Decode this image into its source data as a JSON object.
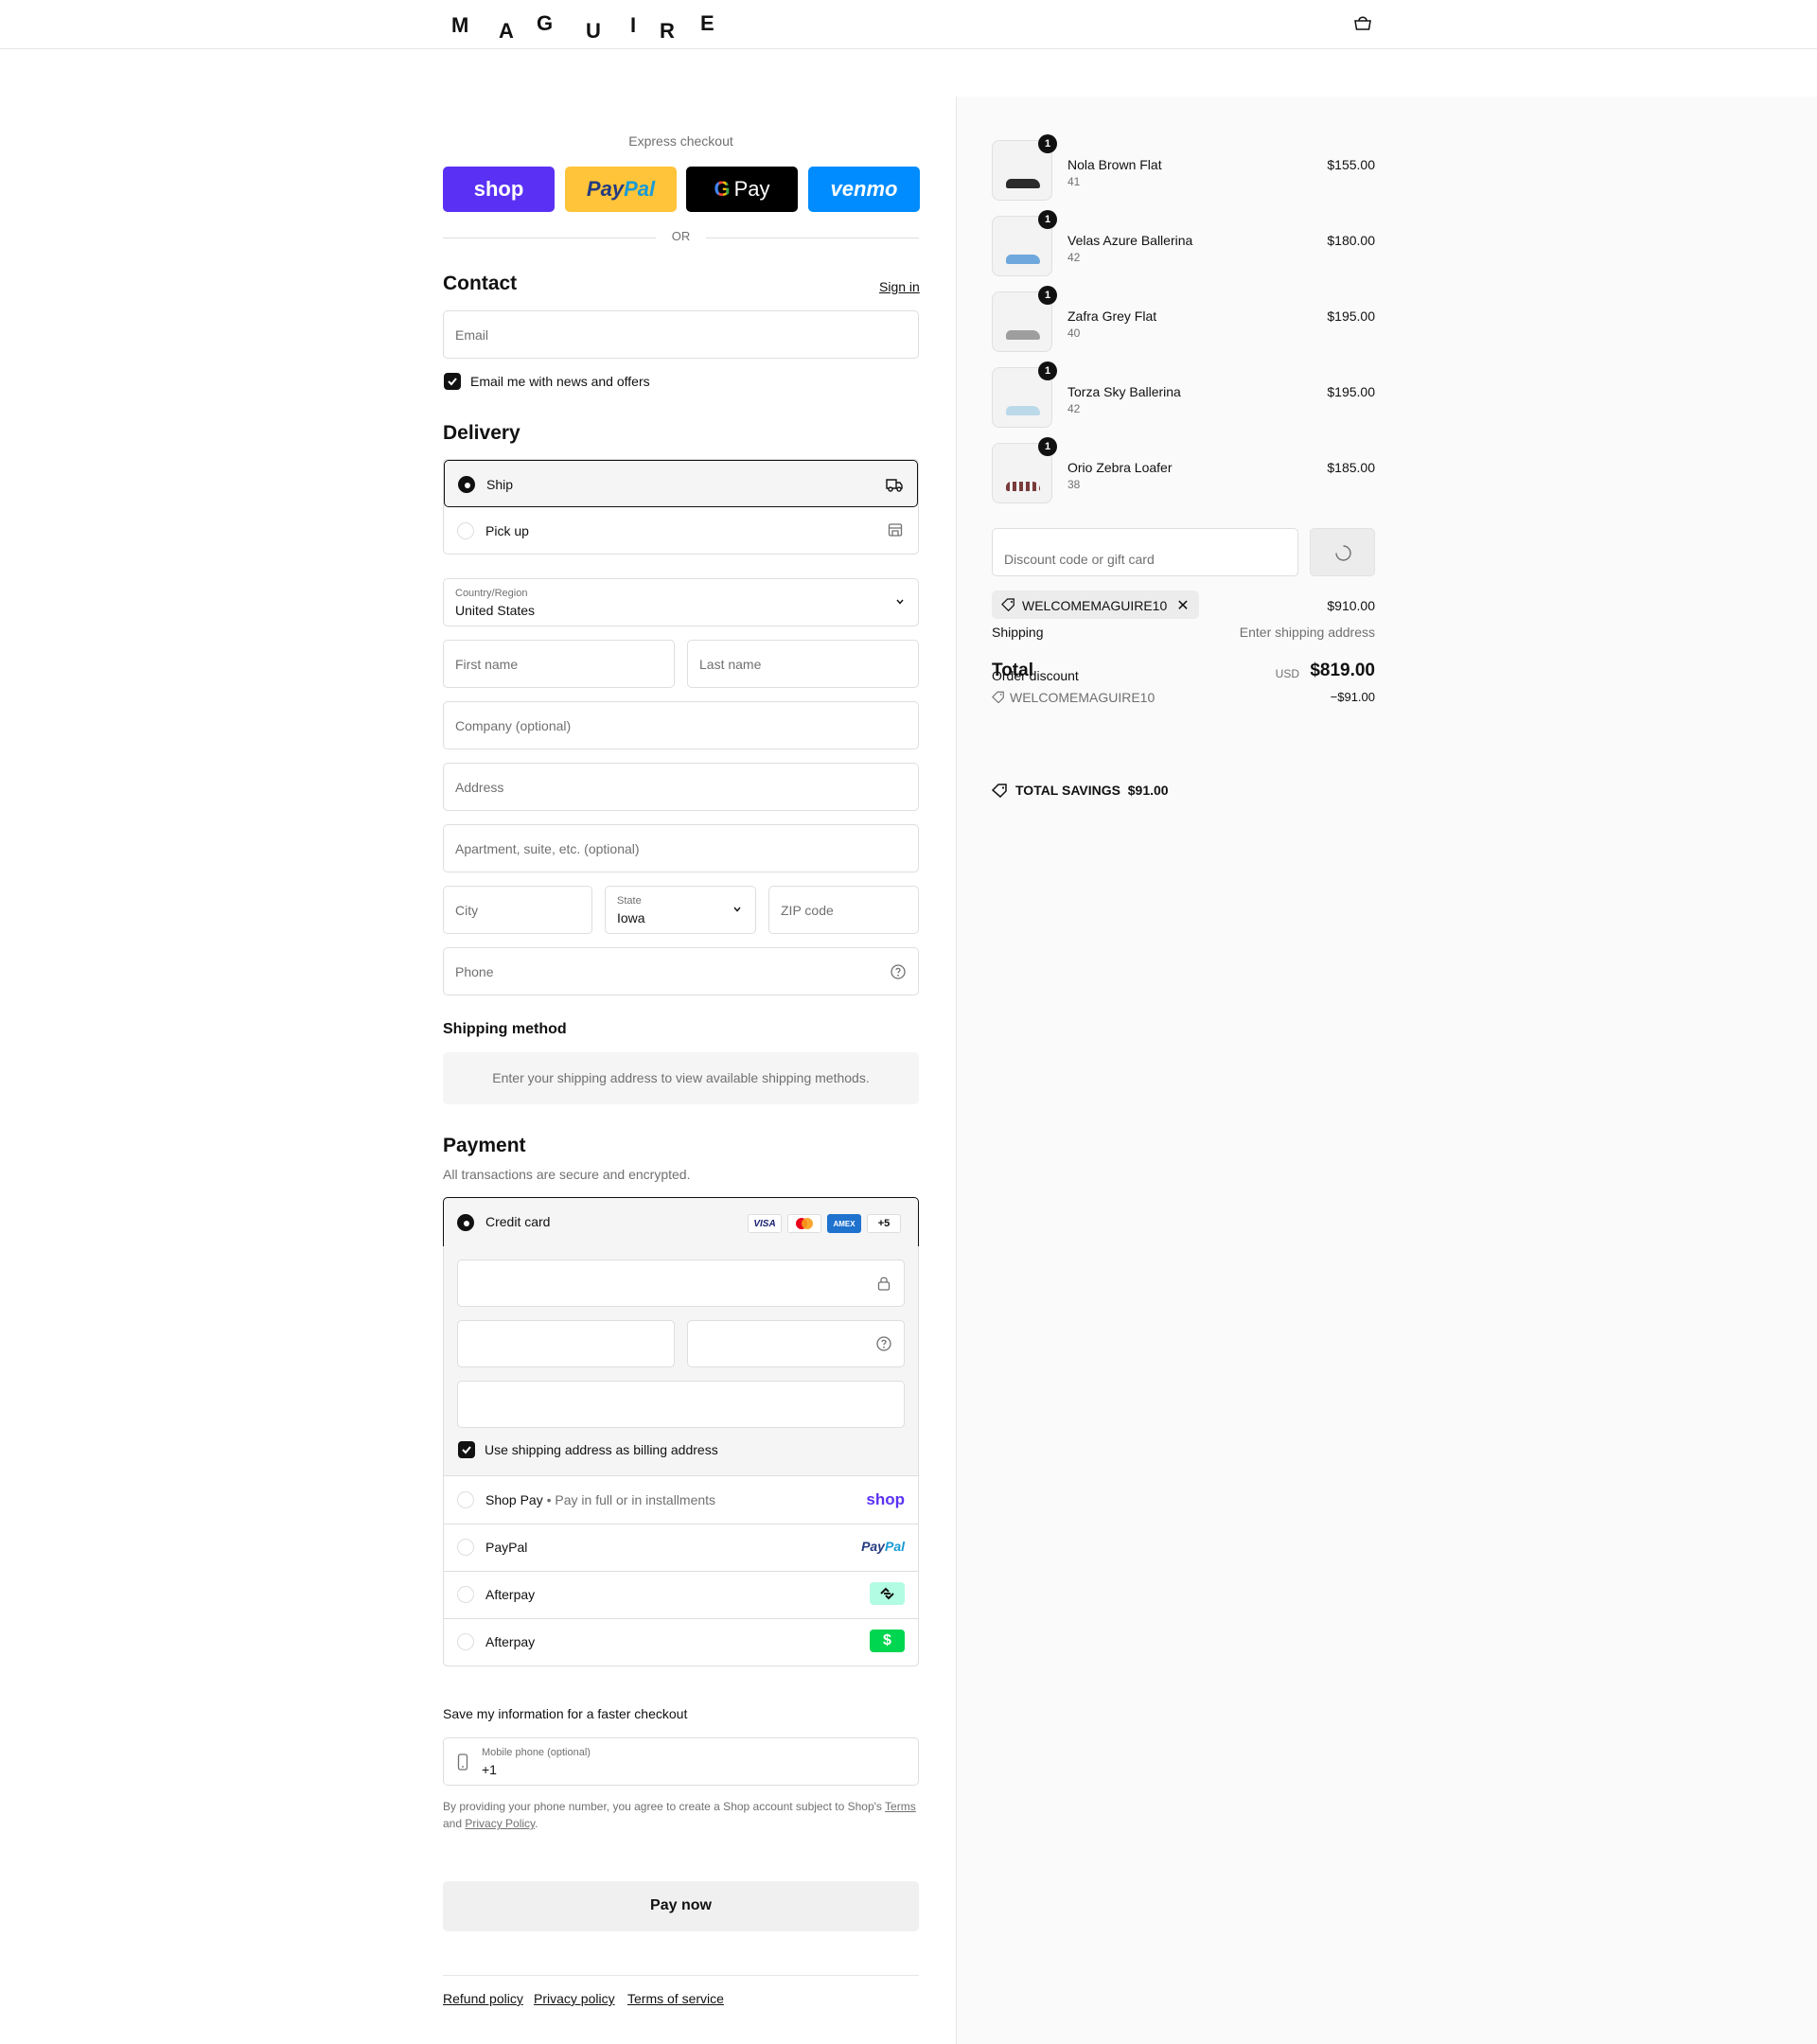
{
  "brand": {
    "letters": [
      "M",
      "A",
      "G",
      "U",
      "I",
      "R",
      "E"
    ]
  },
  "header": {
    "cart_icon": "bag-icon"
  },
  "express": {
    "title": "Express checkout",
    "buttons": {
      "shop": "shop",
      "paypal_a": "Pay",
      "paypal_b": "Pal",
      "gpay_g": "G",
      "gpay": "Pay",
      "venmo": "venmo"
    },
    "or": "OR"
  },
  "contact": {
    "heading": "Contact",
    "sign_in": "Sign in",
    "email_placeholder": "Email",
    "news_label": "Email me with news and offers"
  },
  "delivery": {
    "heading": "Delivery",
    "options": [
      {
        "label": "Ship",
        "icon": "truck-icon"
      },
      {
        "label": "Pick up",
        "icon": "store-icon"
      }
    ],
    "country_label": "Country/Region",
    "country_value": "United States",
    "first_name": "First name",
    "last_name": "Last name",
    "company": "Company (optional)",
    "address": "Address",
    "apartment": "Apartment, suite, etc. (optional)",
    "city": "City",
    "state_label": "State",
    "state_value": "Iowa",
    "zip": "ZIP code",
    "phone": "Phone"
  },
  "shipping_method": {
    "heading": "Shipping method",
    "notice": "Enter your shipping address to view available shipping methods."
  },
  "payment": {
    "heading": "Payment",
    "subtitle": "All transactions are secure and encrypted.",
    "credit_card": "Credit card",
    "brands": [
      "VISA",
      "AMEX"
    ],
    "more": "+5",
    "billing_label": "Use shipping address as billing address",
    "shop_pay": "Shop Pay",
    "shop_pay_sub": "Pay in full or in installments",
    "shop_pay_logo": "shop",
    "paypal": "PayPal",
    "paypal_logo_a": "Pay",
    "paypal_logo_b": "Pal",
    "afterpay_1": "Afterpay",
    "afterpay_2": "Afterpay",
    "cash_symbol": "$"
  },
  "save_info": {
    "heading": "Save my information for a faster checkout",
    "phone_label": "Mobile phone (optional)",
    "phone_value": "+1",
    "legal_1": "By providing your phone number, you agree to create a Shop account subject to Shop's",
    "terms": "Terms",
    "and": "and",
    "privacy": "Privacy Policy",
    "period": "."
  },
  "pay_now": "Pay now",
  "footer": {
    "refund": "Refund policy",
    "privacy": "Privacy policy",
    "terms": "Terms of service"
  },
  "summary": {
    "items": [
      {
        "qty": "1",
        "name": "Nola Brown Flat",
        "size": "41",
        "price": "$155.00",
        "color": "#2b2b2b"
      },
      {
        "qty": "1",
        "name": "Velas Azure Ballerina",
        "size": "42",
        "price": "$180.00",
        "color": "#6fa8dc"
      },
      {
        "qty": "1",
        "name": "Zafra Grey Flat",
        "size": "40",
        "price": "$195.00",
        "color": "#9e9e9e"
      },
      {
        "qty": "1",
        "name": "Torza Sky Ballerina",
        "size": "42",
        "price": "$195.00",
        "color": "#bcd9ea"
      },
      {
        "qty": "1",
        "name": "Orio Zebra Loafer",
        "size": "38",
        "price": "$185.00",
        "color": "#7a3b3b"
      }
    ],
    "discount_placeholder": "Discount code or gift card",
    "code_chip": "WELCOMEMAGUIRE10",
    "subtotal_value": "$910.00",
    "shipping_label": "Shipping",
    "shipping_value": "Enter shipping address",
    "total_label": "Total",
    "order_discount_label": "Order discount",
    "currency": "USD",
    "total_value": "$819.00",
    "discount_code": "WELCOMEMAGUIRE10",
    "discount_value": "−$91.00",
    "savings_label": "TOTAL SAVINGS",
    "savings_value": "$91.00"
  }
}
